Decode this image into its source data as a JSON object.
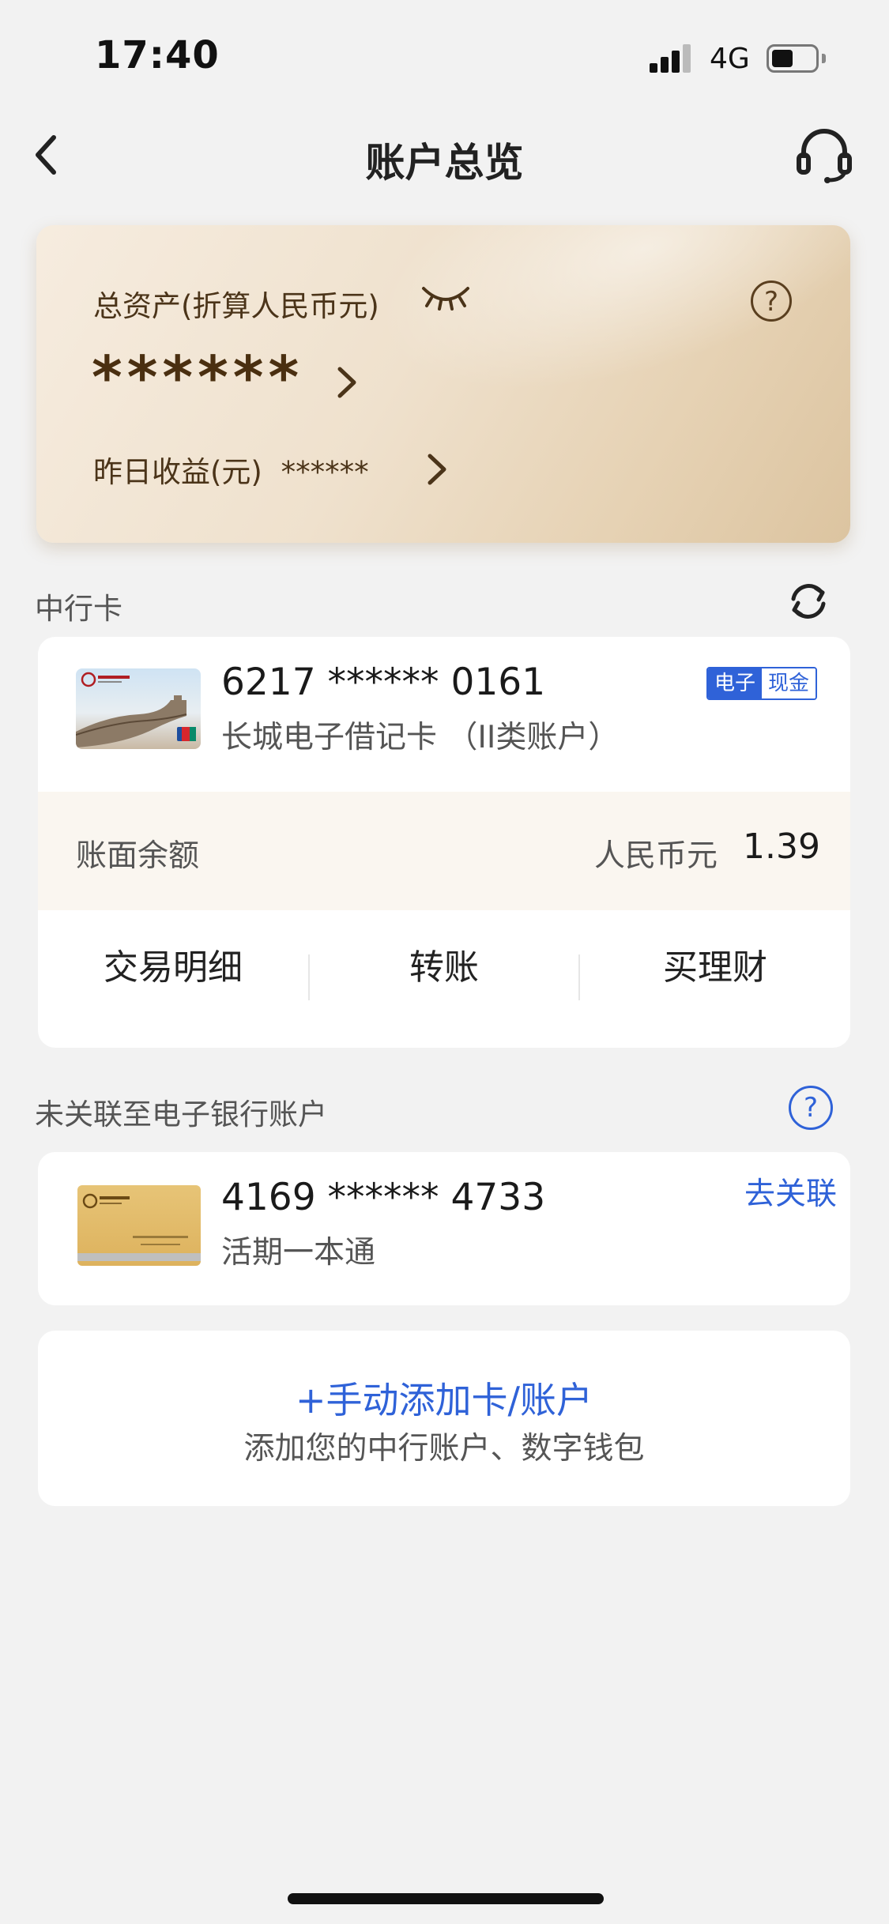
{
  "status_bar": {
    "time": "17:40",
    "network": "4G",
    "battery_level": 0.45
  },
  "nav": {
    "title": "账户总览",
    "back_icon": "chevron-left-icon",
    "support_icon": "headset-icon"
  },
  "assets": {
    "total_label": "总资产(折算人民币元)",
    "total_value": "******",
    "yesterday_label": "昨日收益(元)",
    "yesterday_value": "******",
    "help_glyph": "?"
  },
  "boc_cards": {
    "section_label": "中行卡",
    "card": {
      "number": "6217 ****** 0161",
      "type": "长城电子借记卡 （II类账户）",
      "badge_left": "电子",
      "badge_right": "现金",
      "balance_label": "账面余额",
      "currency": "人民币元",
      "balance": "1.39"
    },
    "actions": [
      "交易明细",
      "转账",
      "买理财"
    ]
  },
  "unlinked": {
    "section_label": "未关联至电子银行账户",
    "help_glyph": "?",
    "card": {
      "number": "4169 ****** 4733",
      "type": "活期一本通",
      "action_label": "去关联"
    }
  },
  "add_card": {
    "title": "+手动添加卡/账户",
    "subtitle": "添加您的中行账户、数字钱包"
  },
  "colors": {
    "accent_blue": "#2f62d8",
    "gold_text": "#4b3419",
    "background": "#f2f2f2"
  }
}
